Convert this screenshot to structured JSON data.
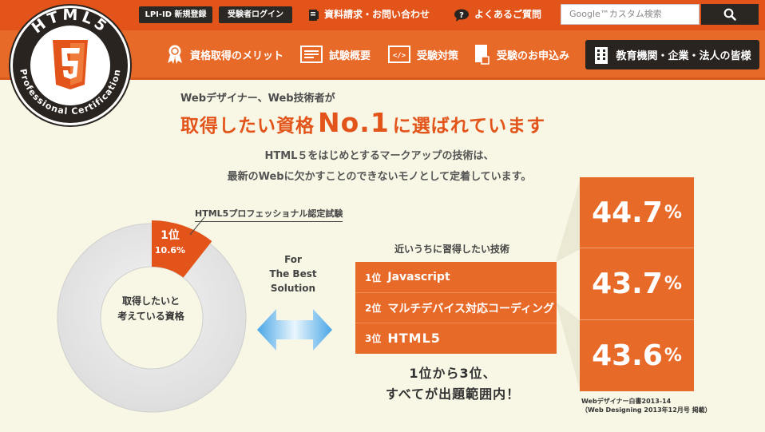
{
  "topbar": {
    "register_label": "LPI-ID 新規登録",
    "login_label": "受験者ログイン",
    "contact_label": "資料請求・お問い合わせ",
    "faq_label": "よくあるご質問",
    "search_placeholder": "Google™カスタム検索"
  },
  "logo": {
    "top_text": "HTML5",
    "ring_text": "Professional Certification"
  },
  "nav": {
    "items": [
      {
        "label": "資格取得のメリット",
        "icon": "award-icon"
      },
      {
        "label": "試験概要",
        "icon": "document-icon"
      },
      {
        "label": "受験対策",
        "icon": "code-icon"
      },
      {
        "label": "受験のお申込み",
        "icon": "application-icon"
      }
    ],
    "corporate_label": "教育機関・企業・法人の皆様"
  },
  "hero": {
    "subheading": "Webデザイナー、Web技術者が",
    "headline_pre": "取得したい資格",
    "headline_no1": "No.1",
    "headline_post": "に選ばれています",
    "description_line1": "HTML５をはじめとするマークアップの技術は、",
    "description_line2": "最新のWebに欠かすことのできないモノとして定着しています。"
  },
  "donut": {
    "label": "HTML5プロフェッショナル認定試験",
    "rank": "1位",
    "percent": "10.6%",
    "value": 10.6,
    "center_line1": "取得したいと",
    "center_line2": "考えている資格"
  },
  "arrow_text": {
    "line1": "For",
    "line2": "The Best",
    "line3": "Solution"
  },
  "ranking": {
    "title": "近いうちに習得したい技術",
    "rows": [
      {
        "pos": "1位",
        "name": "Javascript",
        "percent": "44.7",
        "unit": "%"
      },
      {
        "pos": "2位",
        "name": "マルチデバイス対応コーディング",
        "percent": "43.7",
        "unit": "%"
      },
      {
        "pos": "3位",
        "name": "HTML5",
        "percent": "43.6",
        "unit": "%"
      }
    ],
    "summary_line1": "1位から3位、",
    "summary_line2": "すべてが出題範囲内！",
    "source_line1": "Webデザイナー白書2013-14",
    "source_line2": "（Web Designing 2013年12月号 掲載）"
  },
  "colors": {
    "orange": "#e2541a",
    "nav_orange": "#e86a28",
    "dark": "#2a2420",
    "background": "#f8f6e4"
  }
}
